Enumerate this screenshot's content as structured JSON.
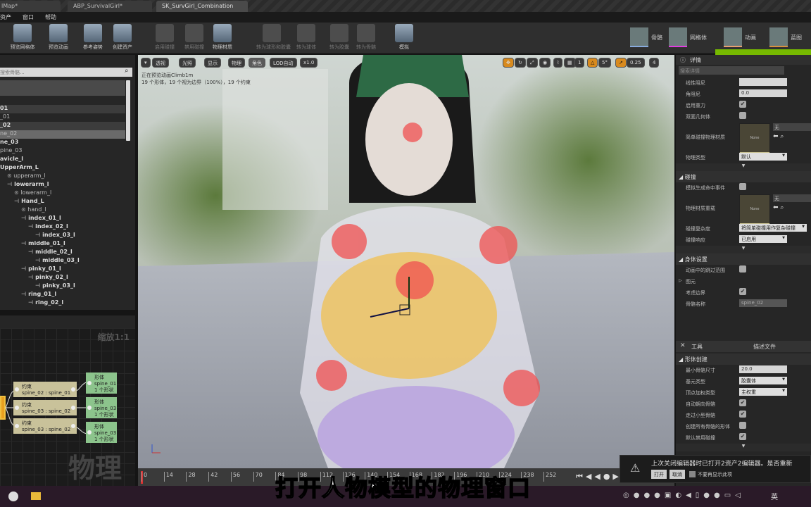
{
  "tabs": [
    "lMap*",
    "ABP_SurvivalGirl*",
    "SK_SurvGirl_Combination"
  ],
  "menu": [
    "资产",
    "窗口",
    "帮助"
  ],
  "toolbar": {
    "buttons": [
      {
        "label": "预览网格体",
        "enabled": true
      },
      {
        "label": "预览动画",
        "enabled": true
      },
      {
        "label": "参考姿势",
        "enabled": true
      },
      {
        "label": "创建资产",
        "enabled": true
      },
      {
        "label": "启用碰撞",
        "enabled": false
      },
      {
        "label": "禁用碰撞",
        "enabled": false
      },
      {
        "label": "物理材质",
        "enabled": true
      },
      {
        "label": "转为球形和胶囊",
        "enabled": false
      },
      {
        "label": "转为球体",
        "enabled": false
      },
      {
        "label": "转为胶囊",
        "enabled": false
      },
      {
        "label": "转为骨骼",
        "enabled": false
      },
      {
        "label": "模拟",
        "enabled": true
      }
    ],
    "modes": [
      {
        "label": "骨骼",
        "color": "#8ad"
      },
      {
        "label": "网格体",
        "color": "#e03ce0"
      },
      {
        "label": "动画",
        "color": "#e8a070"
      },
      {
        "label": "蓝图",
        "color": "#d89040"
      }
    ]
  },
  "skeleton_tree": {
    "search_placeholder": "搜索骨骼...",
    "rows": [
      {
        "label": "01",
        "type": "bone",
        "depth": 0,
        "state": "hdr"
      },
      {
        "label": "_01",
        "type": "body",
        "depth": 0
      },
      {
        "label": "_02",
        "type": "bone",
        "depth": 0,
        "state": "hdr"
      },
      {
        "label": "ne_02",
        "type": "body",
        "depth": 0,
        "state": "sel"
      },
      {
        "label": "ne_03",
        "type": "bone",
        "depth": 0
      },
      {
        "label": "pine_03",
        "type": "body",
        "depth": 0
      },
      {
        "label": "avicle_l",
        "type": "bone",
        "depth": 0
      },
      {
        "label": "UpperArm_L",
        "type": "bone",
        "depth": 0
      },
      {
        "label": "upperarm_l",
        "type": "body",
        "depth": 1
      },
      {
        "label": "lowerarm_l",
        "type": "bone",
        "depth": 1
      },
      {
        "label": "lowerarm_l",
        "type": "body",
        "depth": 2
      },
      {
        "label": "Hand_L",
        "type": "bone",
        "depth": 2
      },
      {
        "label": "hand_l",
        "type": "body",
        "depth": 3
      },
      {
        "label": "index_01_l",
        "type": "bone",
        "depth": 3
      },
      {
        "label": "index_02_l",
        "type": "bone",
        "depth": 4
      },
      {
        "label": "index_03_l",
        "type": "bone",
        "depth": 5
      },
      {
        "label": "middle_01_l",
        "type": "bone",
        "depth": 3
      },
      {
        "label": "middle_02_l",
        "type": "bone",
        "depth": 4
      },
      {
        "label": "middle_03_l",
        "type": "bone",
        "depth": 5
      },
      {
        "label": "pinky_01_l",
        "type": "bone",
        "depth": 3
      },
      {
        "label": "pinky_02_l",
        "type": "bone",
        "depth": 4
      },
      {
        "label": "pinky_03_l",
        "type": "bone",
        "depth": 5
      },
      {
        "label": "ring_01_l",
        "type": "bone",
        "depth": 3
      },
      {
        "label": "ring_02_l",
        "type": "bone",
        "depth": 4
      }
    ]
  },
  "graph": {
    "zoom_label": "缩放1:1",
    "watermark": "物理",
    "constraints": [
      {
        "title": "约束",
        "name": "spine_02 : spine_01"
      },
      {
        "title": "约束",
        "name": "spine_03 : spine_02"
      },
      {
        "title": "约束",
        "name": "spine_03 : spine_02"
      }
    ],
    "bodies": [
      {
        "title": "形体",
        "name": "spine_01",
        "count": "1 个形状"
      },
      {
        "title": "形体",
        "name": "spine_03",
        "count": "1 个形状"
      },
      {
        "title": "形体",
        "name": "spine_03",
        "count": "1 个形状"
      }
    ]
  },
  "viewport": {
    "left_buttons": [
      "透视",
      "光照",
      "显示",
      "物理",
      "角色",
      "LOD自动",
      "x1.0"
    ],
    "right_values": {
      "angle_snap": "5°",
      "scale_snap": "0.25",
      "camera_speed": "4"
    },
    "info_line1": "正在预览动画Climb1m",
    "info_line2": "19 个形体，19 个视为边界（100%），19 个约束"
  },
  "timeline": {
    "ticks": [
      0,
      14,
      28,
      42,
      56,
      70,
      84,
      98,
      112,
      126,
      140,
      154,
      168,
      182,
      196,
      210,
      224,
      238,
      252
    ]
  },
  "subtitle": "打开人物模型的物理窗口",
  "details": {
    "title": "详情",
    "search_placeholder": "搜索详情",
    "rows": [
      {
        "kind": "field",
        "label": "线性阻尼",
        "value": ""
      },
      {
        "kind": "field",
        "label": "角阻尼",
        "value": "0.0"
      },
      {
        "kind": "check",
        "label": "启用重力",
        "checked": true
      },
      {
        "kind": "check",
        "label": "双面几何体",
        "checked": false
      },
      {
        "kind": "asset",
        "label": "简单碰撞物理材质",
        "thumb": "None",
        "value": "无"
      },
      {
        "kind": "select",
        "label": "物理类型",
        "value": "默认"
      },
      {
        "kind": "chevron"
      },
      {
        "kind": "section",
        "label": "碰撞"
      },
      {
        "kind": "check",
        "label": "模拟生成命中事件",
        "checked": false
      },
      {
        "kind": "asset",
        "label": "物理材质重载",
        "thumb": "None",
        "value": "无"
      },
      {
        "kind": "select",
        "label": "碰撞复杂度",
        "value": "将简单碰撞用作复杂碰撞"
      },
      {
        "kind": "select",
        "label": "碰撞响应",
        "value": "已启用"
      },
      {
        "kind": "chevron"
      },
      {
        "kind": "section",
        "label": "身体设置"
      },
      {
        "kind": "check",
        "label": "动画中的跳过范围",
        "checked": false
      },
      {
        "kind": "collapsed",
        "label": "图元"
      },
      {
        "kind": "check",
        "label": "考虑边界",
        "checked": true
      },
      {
        "kind": "disfield",
        "label": "骨骼名称",
        "value": "spine_02"
      }
    ]
  },
  "tools": {
    "tabs": [
      "工具",
      "描述文件"
    ],
    "rows": [
      {
        "kind": "section",
        "label": "形体创建"
      },
      {
        "kind": "field",
        "label": "最小骨骼尺寸",
        "value": "20.0"
      },
      {
        "kind": "select",
        "label": "基元类型",
        "value": "胶囊体"
      },
      {
        "kind": "select",
        "label": "顶点加权类型",
        "value": "主权重"
      },
      {
        "kind": "check",
        "label": "自动朝向骨骼",
        "checked": true
      },
      {
        "kind": "check",
        "label": "走过小型骨骼",
        "checked": true
      },
      {
        "kind": "check",
        "label": "创建所有骨骼的形体",
        "checked": false
      },
      {
        "kind": "check",
        "label": "默认禁用碰撞",
        "checked": true
      },
      {
        "kind": "chevron"
      }
    ]
  },
  "notification": {
    "message": "上次关闭编辑器时已打开2资产2编辑器。是否重新",
    "open": "打开",
    "cancel": "取消",
    "dont_show": "不要再显示此项"
  },
  "taskbar": {
    "ime": "英"
  },
  "colors": {
    "accent_green": "#76b900",
    "snap_orange": "#d88a1e",
    "constraint_node": "#c9c29a",
    "body_node": "#8cc48c"
  }
}
